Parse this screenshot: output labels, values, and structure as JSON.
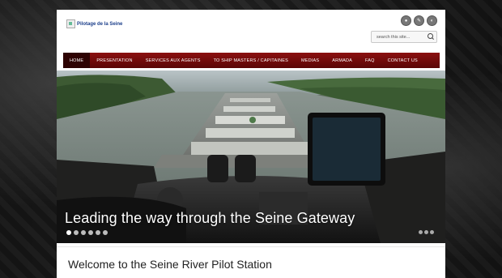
{
  "header": {
    "logo_alt": "Pilotage de la Seine",
    "social": [
      {
        "icon": "user-icon"
      },
      {
        "icon": "pen-icon"
      },
      {
        "icon": "half-icon"
      }
    ],
    "search_placeholder": "search this site..."
  },
  "nav": {
    "items": [
      {
        "label": "HOME",
        "active": true
      },
      {
        "label": "PRESENTATION"
      },
      {
        "label": "SERVICES AUX AGENTS"
      },
      {
        "label": "TO SHIP MASTERS / CAPITAINES"
      },
      {
        "label": "MEDIAS"
      },
      {
        "label": "ARMADA"
      },
      {
        "label": "FAQ"
      },
      {
        "label": "CONTACT US"
      }
    ]
  },
  "hero": {
    "caption": "Leading the way through the Seine Gateway",
    "slides_count": 6,
    "active_slide": 1
  },
  "main": {
    "heading": "Welcome to the Seine River Pilot Station"
  },
  "colors": {
    "nav_bg": "#7a0c0c",
    "nav_active": "#2e0303",
    "page_bg": "#ffffff"
  }
}
